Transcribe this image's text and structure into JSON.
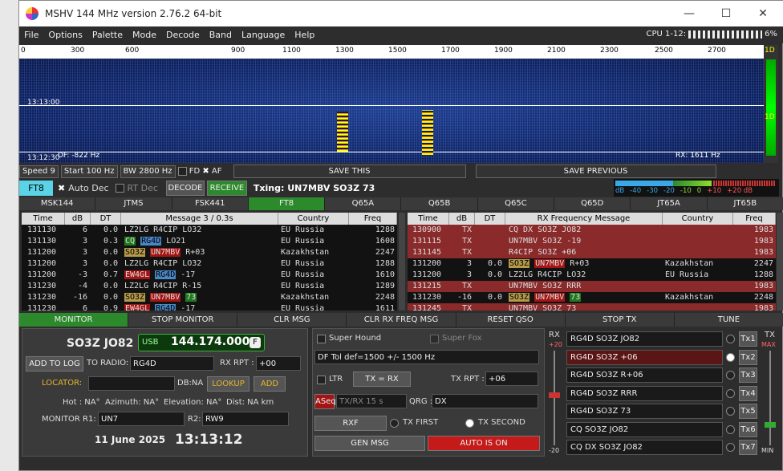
{
  "window": {
    "title": "MSHV 144 MHz version 2.76.2 64-bit",
    "minimize": "—",
    "maximize": "☐",
    "close": "✕"
  },
  "menu": [
    "File",
    "Options",
    "Palette",
    "Mode",
    "Decode",
    "Band",
    "Language",
    "Help"
  ],
  "cpu": {
    "label": "CPU 1-12:",
    "value": "6%"
  },
  "ruler": [
    "0",
    "300",
    "600",
    "900",
    "1100",
    "1300",
    "1500",
    "1700",
    "1900",
    "2100",
    "2300",
    "2500",
    "2700"
  ],
  "waterfall": {
    "time1": "13:13:00",
    "time2": "13:12:30",
    "df": "DF: -822 Hz",
    "rx": "RX: 1611 Hz"
  },
  "side": {
    "top": "1D",
    "mid": "1D"
  },
  "controls1": {
    "speed": "Speed 9",
    "start": "Start 100 Hz",
    "bw": "BW 2800 Hz",
    "fd": "FD",
    "af": "AF",
    "save_this": "SAVE THIS",
    "save_prev": "SAVE PREVIOUS"
  },
  "controls2": {
    "mode": "FT8",
    "autodec": "Auto Dec",
    "rtdec": "RT Dec",
    "decode": "DECODE",
    "receive": "RECEIVE",
    "txing": "Txing: UN7MBV SO3Z 73"
  },
  "meter": {
    "labels": [
      "dB",
      "-40",
      "-30",
      "-20",
      "-10",
      "0",
      "+10",
      "+20 dB"
    ]
  },
  "modes": [
    "MSK144",
    "JTMS",
    "FSK441",
    "FT8",
    "Q65A",
    "Q65B",
    "Q65C",
    "Q65D",
    "JT65A",
    "JT65B"
  ],
  "active_mode": "FT8",
  "left_table": {
    "headers": [
      "Time",
      "dB",
      "DT",
      "Message 3 / 0.3s",
      "Country",
      "Freq"
    ],
    "rows": [
      {
        "time": "131130",
        "db": "6",
        "dt": "0.0",
        "msg": [
          {
            "t": "LZ2LG R4CIP LO32"
          }
        ],
        "country": "EU Russia",
        "freq": "1288"
      },
      {
        "time": "131130",
        "db": "3",
        "dt": "0.3",
        "msg": [
          {
            "t": "CQ",
            "c": "g"
          },
          {
            "t": " "
          },
          {
            "t": "RG4D",
            "c": "b"
          },
          {
            "t": " LO21"
          }
        ],
        "country": "EU Russia",
        "freq": "1608"
      },
      {
        "time": "131200",
        "db": "3",
        "dt": "0.0",
        "msg": [
          {
            "t": "SO3Z",
            "c": "y"
          },
          {
            "t": " "
          },
          {
            "t": "UN7MBV",
            "c": "r"
          },
          {
            "t": " R+03"
          }
        ],
        "country": "Kazakhstan",
        "freq": "2247"
      },
      {
        "time": "131200",
        "db": "3",
        "dt": "0.0",
        "msg": [
          {
            "t": "LZ2LG R4CIP LO32"
          }
        ],
        "country": "EU Russia",
        "freq": "1288"
      },
      {
        "time": "131200",
        "db": "-3",
        "dt": "0.7",
        "msg": [
          {
            "t": "EW4GL",
            "c": "r"
          },
          {
            "t": " "
          },
          {
            "t": "RG4D",
            "c": "b"
          },
          {
            "t": " -17"
          }
        ],
        "country": "EU Russia",
        "freq": "1610"
      },
      {
        "time": "131230",
        "db": "-4",
        "dt": "0.0",
        "msg": [
          {
            "t": "LZ2LG R4CIP R-15"
          }
        ],
        "country": "EU Russia",
        "freq": "1289"
      },
      {
        "time": "131230",
        "db": "-16",
        "dt": "0.0",
        "msg": [
          {
            "t": "SO3Z",
            "c": "y"
          },
          {
            "t": " "
          },
          {
            "t": "UN7MBV",
            "c": "r"
          },
          {
            "t": " "
          },
          {
            "t": "73",
            "c": "g"
          }
        ],
        "country": "Kazakhstan",
        "freq": "2248"
      },
      {
        "time": "131230",
        "db": "6",
        "dt": "0.9",
        "msg": [
          {
            "t": "EW4GL",
            "c": "r"
          },
          {
            "t": " "
          },
          {
            "t": "RG4D",
            "c": "b"
          },
          {
            "t": " -17"
          }
        ],
        "country": "EU Russia",
        "freq": "1611"
      }
    ]
  },
  "right_table": {
    "headers": [
      "Time",
      "dB",
      "DT",
      "RX Frequency Message",
      "Country",
      "Freq"
    ],
    "rows": [
      {
        "time": "130900",
        "db": "TX",
        "dt": "",
        "msg": [
          {
            "t": "CQ DX SO3Z JO82"
          }
        ],
        "country": "",
        "freq": "1983",
        "tx": true
      },
      {
        "time": "131115",
        "db": "TX",
        "dt": "",
        "msg": [
          {
            "t": "UN7MBV SO3Z -19"
          }
        ],
        "country": "",
        "freq": "1983",
        "tx": true
      },
      {
        "time": "131145",
        "db": "TX",
        "dt": "",
        "msg": [
          {
            "t": "R4CIP SO3Z +06"
          }
        ],
        "country": "",
        "freq": "1983",
        "tx": true
      },
      {
        "time": "131200",
        "db": "3",
        "dt": "0.0",
        "msg": [
          {
            "t": "SO3Z",
            "c": "y"
          },
          {
            "t": " "
          },
          {
            "t": "UN7MBV",
            "c": "r"
          },
          {
            "t": " R+03"
          }
        ],
        "country": "Kazakhstan",
        "freq": "2247",
        "tx": false
      },
      {
        "time": "131200",
        "db": "3",
        "dt": "0.0",
        "msg": [
          {
            "t": "LZ2LG R4CIP LO32"
          }
        ],
        "country": "EU Russia",
        "freq": "1288",
        "tx": false
      },
      {
        "time": "131215",
        "db": "TX",
        "dt": "",
        "msg": [
          {
            "t": "UN7MBV SO3Z RRR"
          }
        ],
        "country": "",
        "freq": "1983",
        "tx": true
      },
      {
        "time": "131230",
        "db": "-16",
        "dt": "0.0",
        "msg": [
          {
            "t": "SO3Z",
            "c": "y"
          },
          {
            "t": " "
          },
          {
            "t": "UN7MBV",
            "c": "r"
          },
          {
            "t": " "
          },
          {
            "t": "73",
            "c": "g"
          }
        ],
        "country": "Kazakhstan",
        "freq": "2248",
        "tx": false
      },
      {
        "time": "131245",
        "db": "TX",
        "dt": "",
        "msg": [
          {
            "t": "UN7MBV SO3Z 73"
          }
        ],
        "country": "",
        "freq": "1983",
        "tx": true
      }
    ]
  },
  "bottom": [
    "MONITOR",
    "STOP MONITOR",
    "CLR MSG",
    "CLR RX FREQ MSG",
    "RESET QSO",
    "STOP TX",
    "TUNE"
  ],
  "left_panel": {
    "call": "SO3Z JO82",
    "usb": "USB",
    "freq": "144.174.000",
    "f": "F",
    "add_log": "ADD TO LOG",
    "to_radio": "TO RADIO:",
    "to_radio_val": "RG4D",
    "rx_rpt": "RX RPT :",
    "rx_rpt_val": "+00",
    "locator": "LOCATOR:",
    "dbna": "DB:NA",
    "lookup": "LOOKUP",
    "add": "ADD",
    "hot": "Hot : NA°",
    "azimuth": "Azimuth: NA°",
    "elevation": "Elevation: NA°",
    "dist": "Dist: NA km",
    "monitor_r1": "MONITOR R1:",
    "r1": "UN7",
    "r2lbl": "R2:",
    "r2": "RW9",
    "date": "11 June 2025",
    "time": "13:13:12"
  },
  "mid_panel": {
    "superhound": "Super Hound",
    "superfox": "Super Fox",
    "dftol": "DF Tol def=1500 +/-  1500  Hz",
    "ltr": "LTR",
    "txrx": "TX  =  RX",
    "txrpt": "TX RPT :",
    "txrpt_val": "+06",
    "aseq": "ASeq",
    "txrx15": "TX/RX 15  s",
    "qrg": "QRG :",
    "qrg_val": "DX",
    "rxf": "RXF",
    "txfirst": "TX FIRST",
    "txsecond": "TX SECOND",
    "genmsg": "GEN MSG",
    "auto": "AUTO IS ON"
  },
  "right_panel": {
    "rx": "RX",
    "rxplus": "+20",
    "rxminus": "-20",
    "tx": "TX",
    "txmax": "MAX",
    "txmin": "MIN",
    "msgs": [
      "RG4D SO3Z JO82",
      "RG4D SO3Z +06",
      "RG4D SO3Z R+06",
      "RG4D SO3Z RRR",
      "RG4D SO3Z 73",
      "CQ SO3Z JO82",
      "CQ DX SO3Z JO82"
    ],
    "btns": [
      "Tx1",
      "Tx2",
      "Tx3",
      "Tx4",
      "Tx5",
      "Tx6",
      "Tx7"
    ],
    "selected": 1
  }
}
